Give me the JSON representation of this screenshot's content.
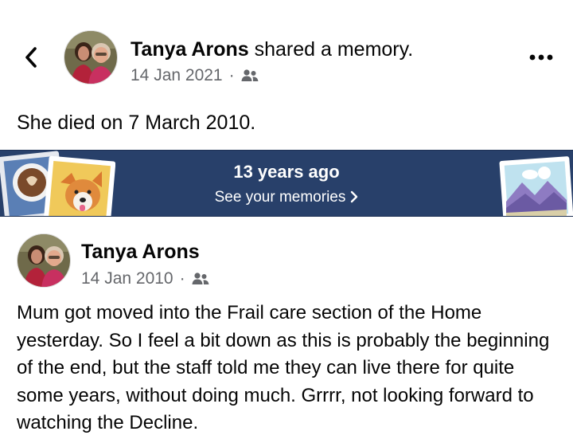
{
  "header": {
    "author": "Tanya Arons",
    "action": "shared a memory.",
    "date": "14 Jan 2021",
    "separator": "·",
    "audience_icon": "friends-icon",
    "back_icon": "chevron-left-icon",
    "more_icon": "more-horizontal-icon"
  },
  "shared_text": "She died on 7 March 2010.",
  "memory_banner": {
    "title": "13 years ago",
    "link_label": "See your memories",
    "link_icon": "chevron-right-icon",
    "background_color": "#28406a"
  },
  "original_post": {
    "author": "Tanya Arons",
    "date": "14 Jan 2010",
    "separator": "·",
    "audience_icon": "friends-icon",
    "body": "Mum got moved into the Frail care section of the Home yesterday.  So I feel a bit down as this is probably the beginning of the end, but the staff told me they can live there for quite some years, without doing much.  Grrrr, not looking forward to watching the Decline."
  }
}
